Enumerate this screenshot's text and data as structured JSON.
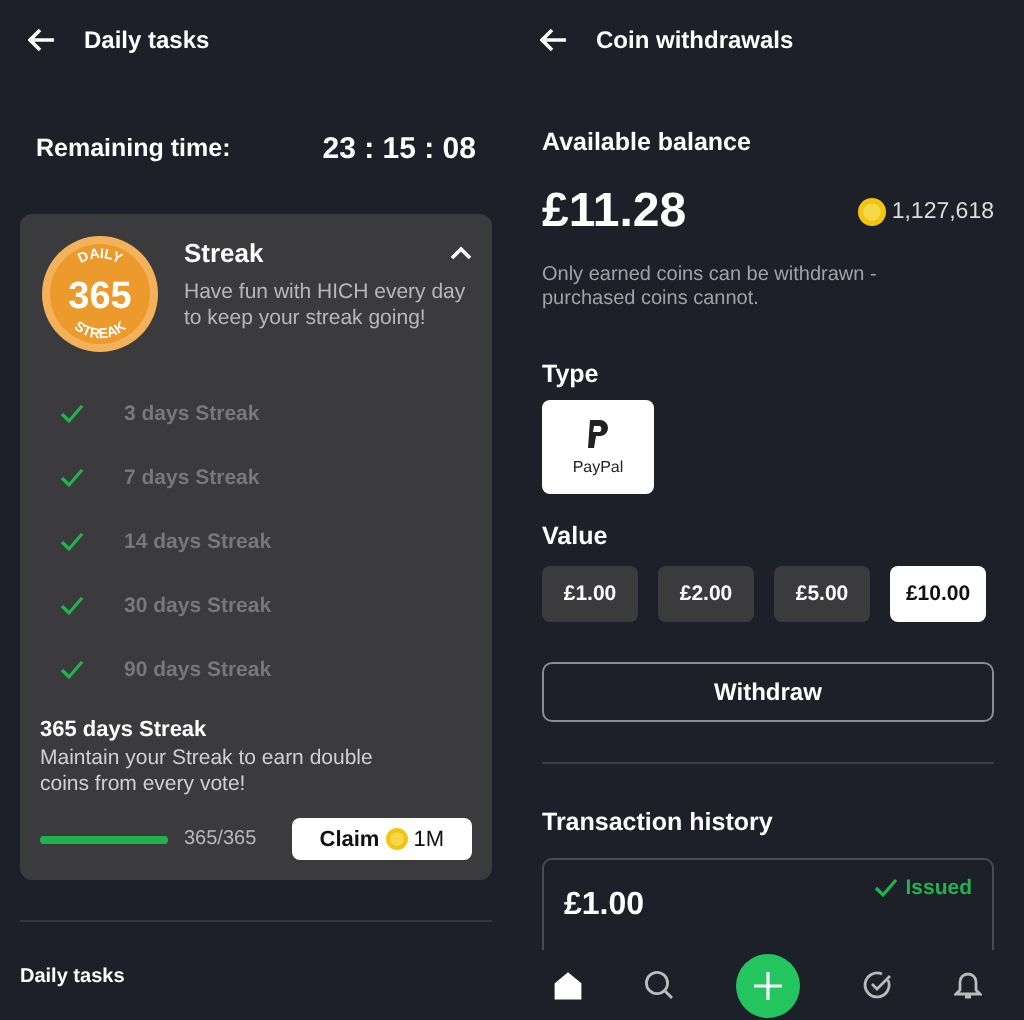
{
  "daily_tasks_screen": {
    "title": "Daily tasks",
    "remaining_label": "Remaining time:",
    "remaining_time": "23 : 15 : 08",
    "streak_card": {
      "badge": {
        "top": "DAILY",
        "number": "365",
        "bottom": "STREAK"
      },
      "title": "Streak",
      "description": "Have fun with HICH every day to keep your streak going!",
      "expanded": true,
      "milestones": [
        {
          "label": "3 days Streak",
          "done": true
        },
        {
          "label": "7 days Streak",
          "done": true
        },
        {
          "label": "14 days Streak",
          "done": true
        },
        {
          "label": "30 days Streak",
          "done": true
        },
        {
          "label": "90 days Streak",
          "done": true
        }
      ],
      "goal": {
        "title": "365 days Streak",
        "description": "Maintain your Streak to earn double coins from every vote!",
        "level": 1,
        "reading": "365/365",
        "claim_label": "Claim",
        "claim_amount": "1M"
      }
    },
    "section_title": "Daily tasks"
  },
  "withdrawals_screen": {
    "title": "Coin withdrawals",
    "balance_label": "Available balance",
    "balance": "£11.28",
    "coins": "1,127,618",
    "note": "Only earned coins can be withdrawn - purchased coins cannot.",
    "type_label": "Type",
    "types": [
      {
        "label": "PayPal",
        "selected": true
      }
    ],
    "value_label": "Value",
    "values": [
      {
        "label": "£1.00",
        "selected": false
      },
      {
        "label": "£2.00",
        "selected": false
      },
      {
        "label": "£5.00",
        "selected": false
      },
      {
        "label": "£10.00",
        "selected": true
      }
    ],
    "withdraw_label": "Withdraw",
    "history_title": "Transaction history",
    "transactions": [
      {
        "amount": "£1.00",
        "status": "Issued"
      }
    ]
  },
  "nav": [
    {
      "kind": "home",
      "selected": true
    },
    {
      "kind": "search",
      "selected": false
    },
    {
      "kind": "add",
      "selected": false
    },
    {
      "kind": "tasks",
      "selected": false
    },
    {
      "kind": "notifications",
      "selected": false
    }
  ]
}
